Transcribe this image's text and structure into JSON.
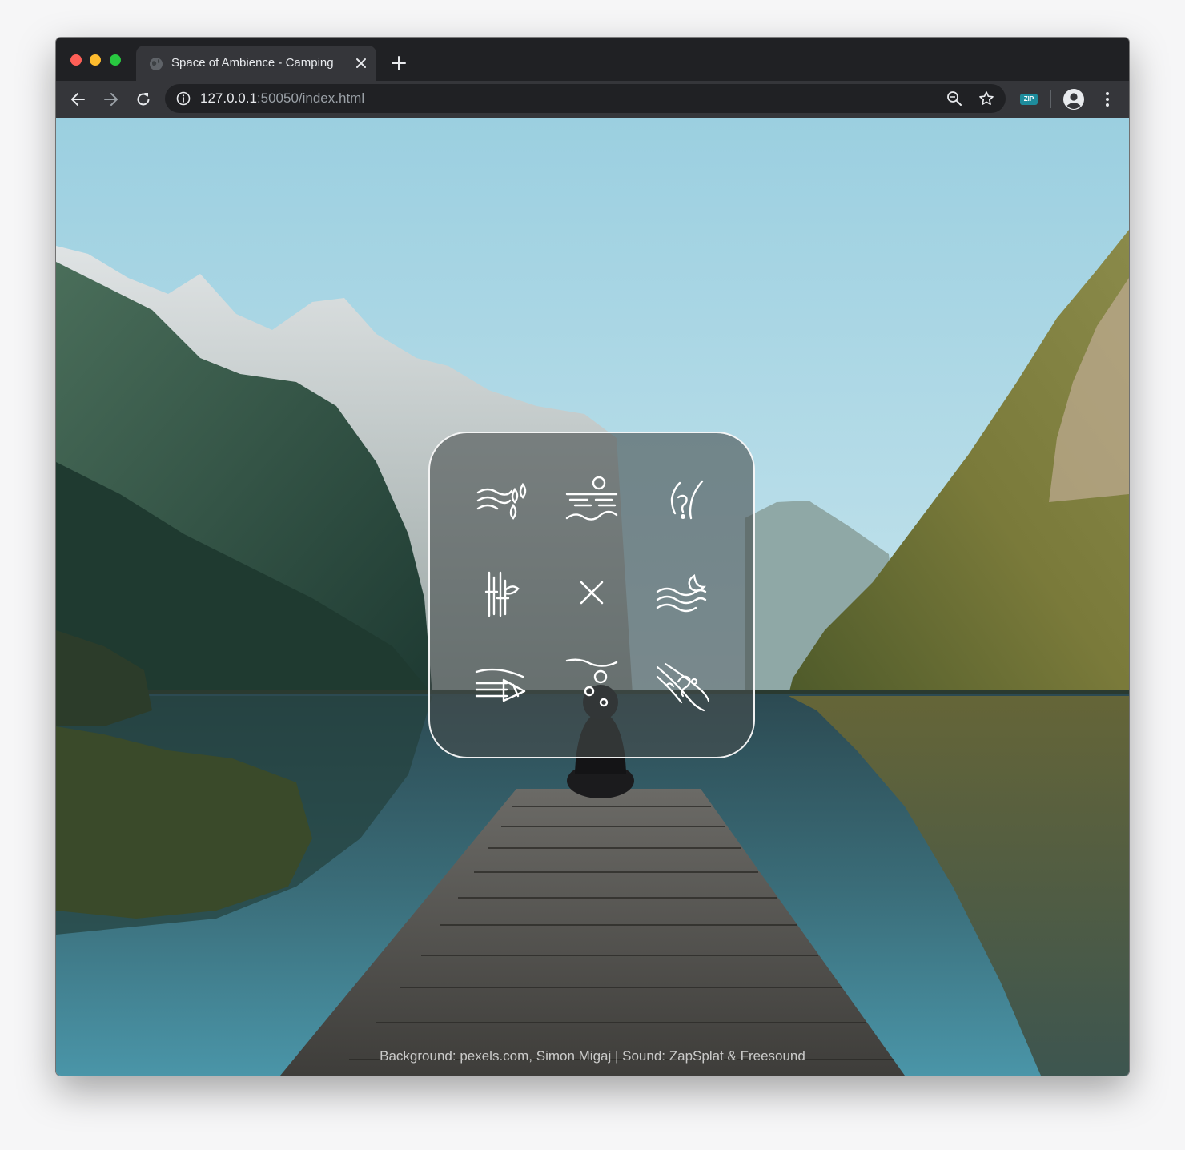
{
  "browser": {
    "tab_title": "Space of Ambience - Camping",
    "url_host": "127.0.0.1",
    "url_rest": ":50050/index.html",
    "extension_label": "ZIP"
  },
  "page": {
    "credits": "Background: pexels.com, Simon Migaj | Sound: ZapSplat & Freesound",
    "sounds": [
      {
        "icon": "wind-rain-icon"
      },
      {
        "icon": "sunset-sea-icon"
      },
      {
        "icon": "night-bird-icon"
      },
      {
        "icon": "reeds-icon"
      },
      {
        "icon": "close-icon"
      },
      {
        "icon": "night-waves-icon"
      },
      {
        "icon": "wind-horn-icon"
      },
      {
        "icon": "underwater-bubbles-icon"
      },
      {
        "icon": "stream-icon"
      }
    ]
  },
  "colors": {
    "accent_panel_border": "#ffffff",
    "titlebar": "#202124",
    "toolbar": "#35363a"
  }
}
